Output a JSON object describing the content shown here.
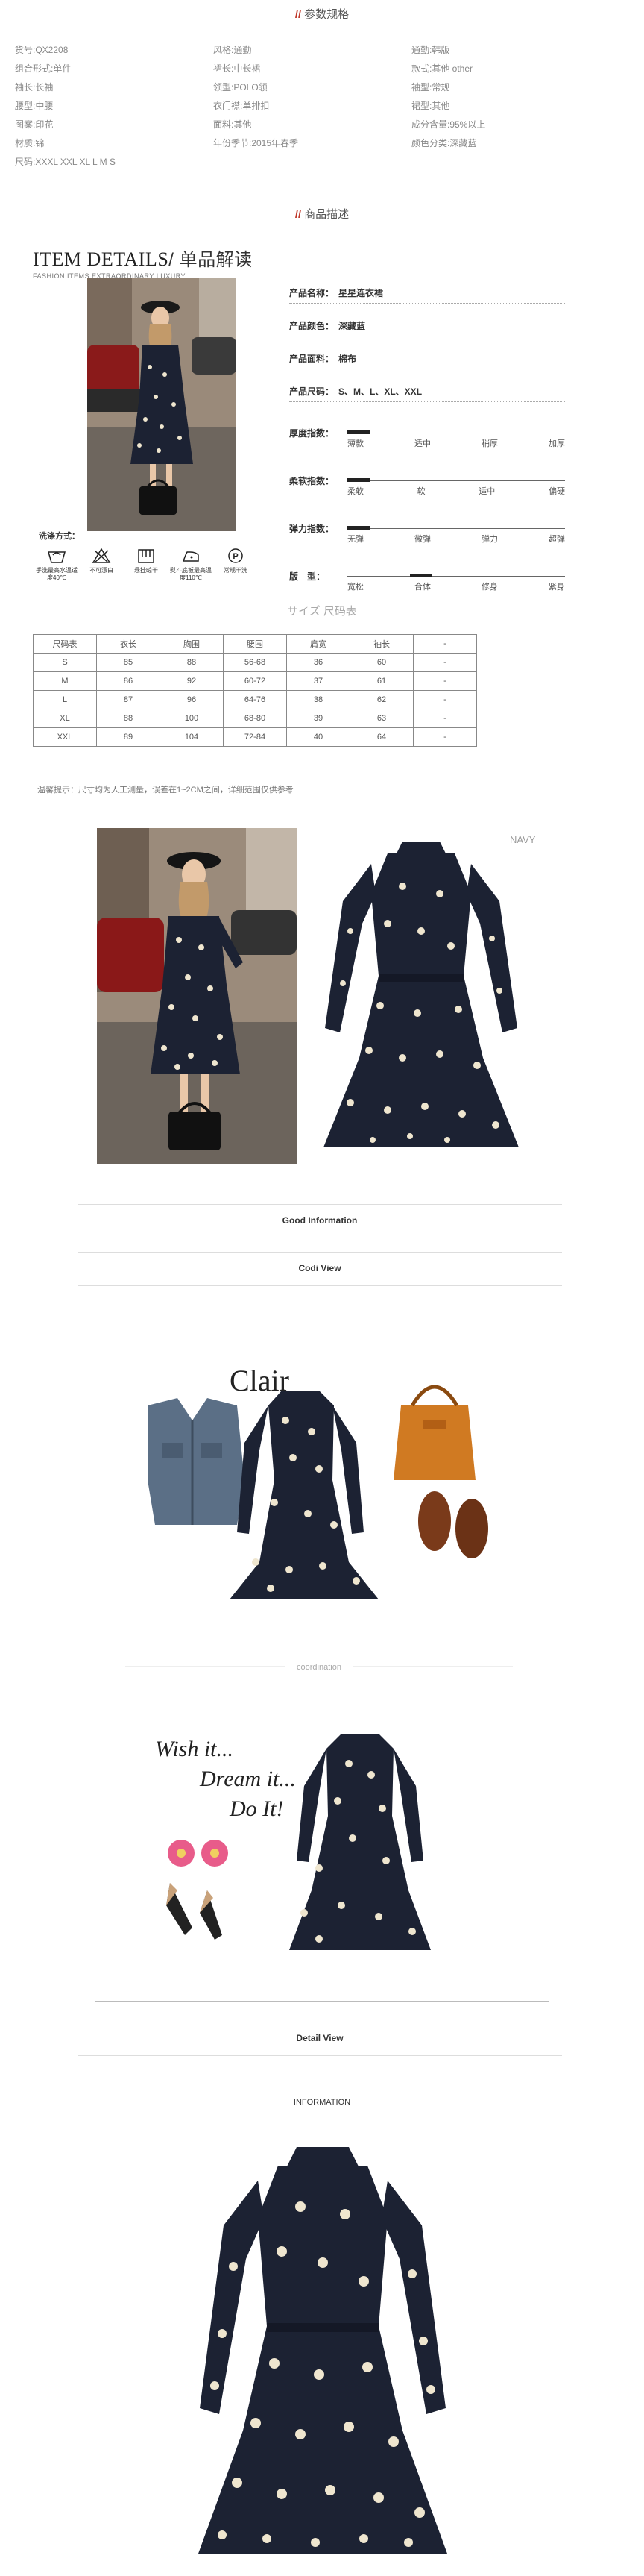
{
  "headers": {
    "params_title": "参数规格",
    "desc_title": "商品描述"
  },
  "params": [
    [
      "货号:QX2208",
      "风格:通勤",
      "通勤:韩版"
    ],
    [
      "组合形式:单件",
      "裙长:中长裙",
      "款式:其他 other"
    ],
    [
      "袖长:长袖",
      "领型:POLO领",
      "袖型:常规"
    ],
    [
      "腰型:中腰",
      "衣门襟:单排扣",
      "裙型:其他"
    ],
    [
      "图案:印花",
      "面料:其他",
      "成分含量:95%以上"
    ],
    [
      "材质:锦",
      "年份季节:2015年春季",
      "颜色分类:深藏蓝"
    ],
    [
      "尺码:XXXL XXL XL L M S"
    ]
  ],
  "item_details": {
    "title": "ITEM DETAILS",
    "title_cn": "/ 单品解读",
    "subtitle": "FASHION ITEMS EXTRAORDINARY LUXURY"
  },
  "product_info": [
    {
      "label": "产品名称：",
      "value": "星星连衣裙"
    },
    {
      "label": "产品颜色：",
      "value": "深藏蓝"
    },
    {
      "label": "产品面料：",
      "value": "棉布"
    },
    {
      "label": "产品尺码：",
      "value": "S、M、L、XL、XXL"
    }
  ],
  "scales": [
    {
      "label": "厚度指数：",
      "options": [
        "薄款",
        "适中",
        "稍厚",
        "加厚"
      ],
      "selected_index": 0
    },
    {
      "label": "柔软指数：",
      "options": [
        "柔软",
        "软",
        "适中",
        "偏硬"
      ],
      "selected_index": 0
    },
    {
      "label": "弹力指数：",
      "options": [
        "无弹",
        "微弹",
        "弹力",
        "超弹"
      ],
      "selected_index": 0
    },
    {
      "label": "版　型：",
      "options": [
        "宽松",
        "合体",
        "修身",
        "紧身"
      ],
      "selected_index": 1
    }
  ],
  "wash": {
    "title": "洗涤方式：",
    "items": [
      {
        "label": "手洗最高水温适度40℃",
        "icon": "hand-wash-icon"
      },
      {
        "label": "不可漂白",
        "icon": "no-bleach-icon"
      },
      {
        "label": "悬挂晾干",
        "icon": "hang-dry-icon"
      },
      {
        "label": "熨斗底板最高温度110℃",
        "icon": "iron-icon"
      },
      {
        "label": "常规干洗",
        "icon": "dry-clean-icon"
      }
    ]
  },
  "size_chart": {
    "title": "サイズ 尺码表",
    "headers": [
      "尺码表",
      "衣长",
      "胸围",
      "腰围",
      "肩宽",
      "袖长",
      "-"
    ],
    "rows": [
      [
        "S",
        "85",
        "88",
        "56-68",
        "36",
        "60",
        "-"
      ],
      [
        "M",
        "86",
        "92",
        "60-72",
        "37",
        "61",
        "-"
      ],
      [
        "L",
        "87",
        "96",
        "64-76",
        "38",
        "62",
        "-"
      ],
      [
        "XL",
        "88",
        "100",
        "68-80",
        "39",
        "63",
        "-"
      ],
      [
        "XXL",
        "89",
        "104",
        "72-84",
        "40",
        "64",
        "-"
      ]
    ],
    "note": "温馨提示：尺寸均为人工测量，误差在1~2CM之间，详细范围仅供参考"
  },
  "color_label": "NAVY",
  "bars": {
    "good_info": "Good Information",
    "codi_view": "Codi View",
    "detail_view": "Detail View"
  },
  "codi": {
    "brand": "Clair",
    "coordination": "coordination",
    "script_lines": [
      "Wish it...",
      "Dream it...",
      "Do It!"
    ]
  },
  "information_label": "INFORMATION",
  "colors": {
    "navy": "#1c2233",
    "star": "#efe6cf",
    "accent": "#c0392b"
  }
}
